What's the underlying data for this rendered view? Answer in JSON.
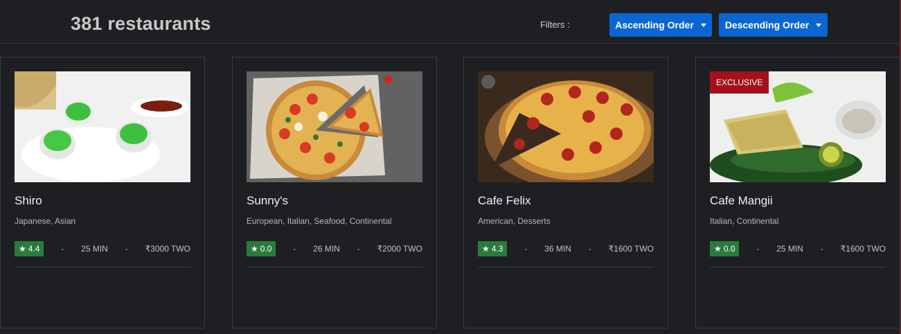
{
  "header": {
    "title": "381 restaurants",
    "filters_label": "Filters :",
    "ascending_label": "Ascending Order",
    "descending_label": "Descending Order",
    "button_color": "#0a66d1"
  },
  "restaurants": [
    {
      "name": "Shiro",
      "cuisine": "Japanese, Asian",
      "rating": "4.4",
      "time": "25 MIN",
      "cost": "₹3000 TWO",
      "badge": ""
    },
    {
      "name": "Sunny's",
      "cuisine": "European, Italian, Seafood, Continental",
      "rating": "0.0",
      "time": "26 MIN",
      "cost": "₹2000 TWO",
      "badge": ""
    },
    {
      "name": "Cafe Felix",
      "cuisine": "American, Desserts",
      "rating": "4.3",
      "time": "36 MIN",
      "cost": "₹1600 TWO",
      "badge": ""
    },
    {
      "name": "Cafe Mangii",
      "cuisine": "Italian, Continental",
      "rating": "0.0",
      "time": "25 MIN",
      "cost": "₹1600 TWO",
      "badge": "EXCLUSIVE"
    }
  ],
  "icons": {
    "star": "star-icon",
    "dropdown": "caret-down-icon"
  },
  "colors": {
    "rating_bg": "#2b7a3d",
    "badge_bg": "#a5111b",
    "background": "#1e1f22"
  }
}
